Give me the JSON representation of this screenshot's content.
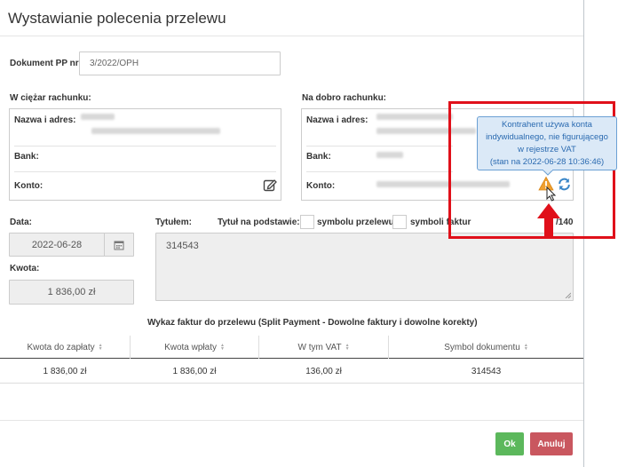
{
  "window": {
    "title": "Wystawianie polecenia przelewu"
  },
  "document": {
    "label": "Dokument PP nr:",
    "value": "3/2022/OPH"
  },
  "payer": {
    "section_label": "W ciężar rachunku:",
    "name_label": "Nazwa i adres:",
    "bank_label": "Bank:",
    "account_label": "Konto:"
  },
  "payee": {
    "section_label": "Na dobro rachunku:",
    "name_label": "Nazwa i adres:",
    "bank_label": "Bank:",
    "account_label": "Konto:"
  },
  "date": {
    "label": "Data:",
    "value": "2022-06-28"
  },
  "amount": {
    "label": "Kwota:",
    "value": "1 836,00 zł"
  },
  "title_field": {
    "label": "Tytułem:",
    "basis_label": "Tytuł na podstawie:",
    "option_transfer": "symbolu przelewu",
    "option_invoices": "symboli faktur",
    "counter": "/140",
    "value": "314543"
  },
  "invoices": {
    "heading": "Wykaz faktur do przelewu (Split Payment - Dowolne faktury i dowolne korekty)",
    "columns": [
      "Kwota do zapłaty",
      "Kwota wpłaty",
      "W tym VAT",
      "Symbol dokumentu"
    ],
    "rows": [
      {
        "to_pay": "1 836,00 zł",
        "paid": "1 836,00 zł",
        "vat": "136,00 zł",
        "symbol": "314543"
      }
    ]
  },
  "tooltip": {
    "line1": "Kontrahent używa konta",
    "line2": "indywidualnego, nie figurującego",
    "line3": "w rejestrze VAT",
    "line4": "(stan na 2022-06-28 10:36:46)"
  },
  "buttons": {
    "ok": "Ok",
    "cancel": "Anuluj"
  },
  "colors": {
    "ok": "#5cb85c",
    "cancel": "#c9575f",
    "annotation": "#e0101a",
    "warning": "#f0a030",
    "tooltip_text": "#2a6ab0"
  },
  "icons": [
    "edit-icon",
    "calendar-icon",
    "warning-icon",
    "refresh-icon",
    "sort-icon",
    "arrow-up-icon",
    "mouse-cursor-icon"
  ]
}
